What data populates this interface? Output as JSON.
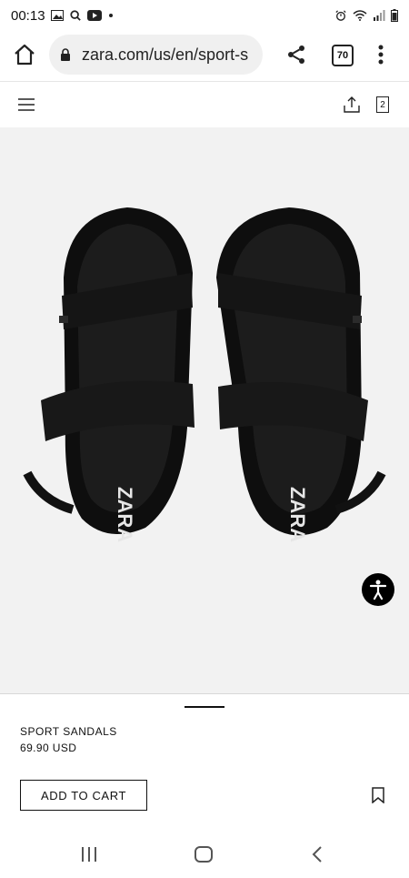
{
  "status": {
    "time": "00:13",
    "left_icons": [
      "image-icon",
      "search-icon",
      "youtube-icon",
      "dot-icon"
    ],
    "right_icons": [
      "alarm-icon",
      "wifi-icon",
      "signal-icon",
      "battery-icon"
    ]
  },
  "browser": {
    "url": "zara.com/us/en/sport-s",
    "tab_count": "70"
  },
  "site": {
    "bag_count": "2"
  },
  "product": {
    "name": "SPORT SANDALS",
    "price": "69.90 USD",
    "add_to_cart_label": "ADD TO CART",
    "image_alt": "Black sport sandals, top view",
    "brand_print": "ZARA"
  },
  "colors": {
    "hero_bg": "#f2f2f2",
    "sandal": "#121212",
    "accent": "#000000"
  }
}
